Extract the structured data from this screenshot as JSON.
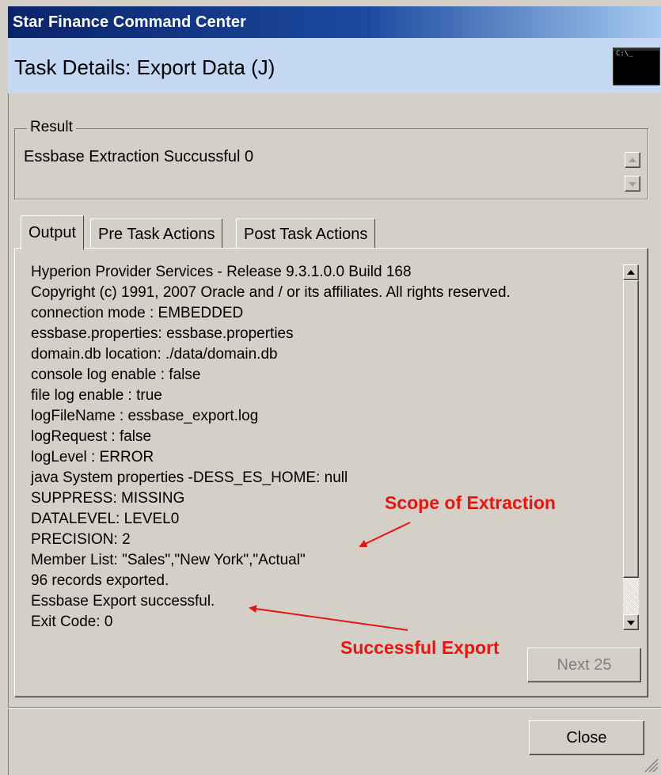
{
  "window": {
    "title": "Star Finance Command Center"
  },
  "header": {
    "title": "Task Details: Export Data (J)",
    "icon": "console-icon",
    "icon_text": "C:\\_"
  },
  "result": {
    "legend": "Result",
    "text": "Essbase Extraction Succussful 0"
  },
  "tabs": [
    {
      "label": "Output",
      "active": true
    },
    {
      "label": "Pre Task Actions",
      "active": false
    },
    {
      "label": "Post Task Actions",
      "active": false
    }
  ],
  "output": {
    "lines": [
      "Hyperion Provider Services - Release 9.3.1.0.0 Build 168",
      "Copyright (c) 1991, 2007 Oracle and / or its affiliates. All rights reserved.",
      "connection mode : EMBEDDED",
      "essbase.properties: essbase.properties",
      "domain.db location: ./data/domain.db",
      "console log enable : false",
      "file log enable : true",
      "logFileName : essbase_export.log",
      "logRequest : false",
      "logLevel : ERROR",
      "java System properties -DESS_ES_HOME: null",
      "SUPPRESS: MISSING",
      "DATALEVEL: LEVEL0",
      "PRECISION: 2",
      "Member List: \"Sales\",\"New York\",\"Actual\"",
      "96 records exported.",
      "Essbase Export successful.",
      "Exit Code: 0"
    ]
  },
  "annotations": {
    "scope": "Scope of Extraction",
    "success": "Successful Export",
    "color": "#e8140f"
  },
  "buttons": {
    "next": "Next 25",
    "close": "Close"
  },
  "colors": {
    "titlebar_start": "#0a246a",
    "header_bg": "#c4d8f4",
    "face": "#d4d0c8"
  }
}
